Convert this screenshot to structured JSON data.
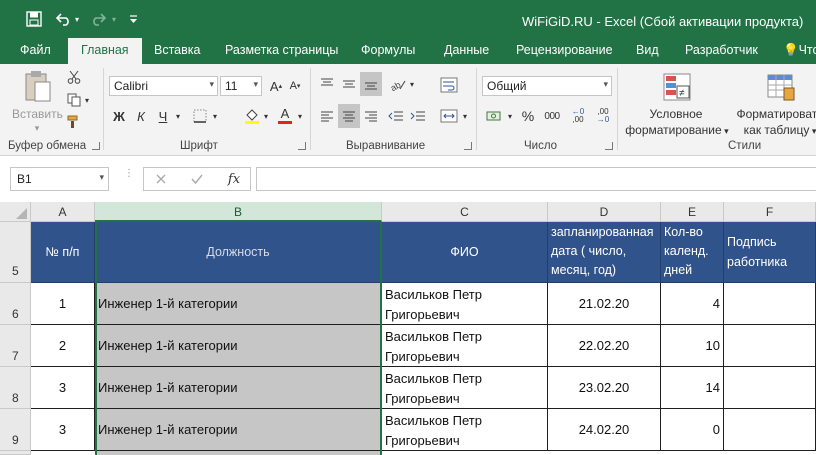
{
  "window": {
    "title": "WiFiGiD.RU - Excel (Сбой активации продукта)"
  },
  "tabs": [
    {
      "label": "Файл"
    },
    {
      "label": "Главная"
    },
    {
      "label": "Вставка"
    },
    {
      "label": "Разметка страницы"
    },
    {
      "label": "Формулы"
    },
    {
      "label": "Данные"
    },
    {
      "label": "Рецензирование"
    },
    {
      "label": "Вид"
    },
    {
      "label": "Разработчик"
    },
    {
      "label": "Что"
    }
  ],
  "ribbon": {
    "clipboard": {
      "label": "Буфер обмена",
      "paste_label": "Вставить"
    },
    "font": {
      "label": "Шрифт",
      "font_name": "Calibri",
      "font_size": "11",
      "bold": "Ж",
      "italic": "К",
      "underline": "Ч",
      "font_color_letter": "А"
    },
    "alignment": {
      "label": "Выравнивание"
    },
    "number": {
      "label": "Число",
      "format": "Общий",
      "percent": "%",
      "thousands": "000"
    },
    "styles": {
      "label": "Стили",
      "conditional_line1": "Условное",
      "conditional_line2": "форматирование",
      "table_line1": "Форматировать",
      "table_line2": "как таблицу"
    }
  },
  "formula_bar": {
    "name_box": "B1",
    "fx": "fx",
    "formula": ""
  },
  "columns": [
    "A",
    "B",
    "C",
    "D",
    "E",
    "F"
  ],
  "header_row": {
    "row_num": "5",
    "a": "№ п/п",
    "b": "Должность",
    "c": "ФИО",
    "d": "запланированная дата ( число, месяц, год)",
    "e": "Кол-во календ. дней",
    "f": "Подпись работника"
  },
  "rows": [
    {
      "row_num": "6",
      "a": "1",
      "b": "Инженер 1-й категории",
      "c": "Васильков Петр Григорьевич",
      "d": "21.02.20",
      "e": "4",
      "f": ""
    },
    {
      "row_num": "7",
      "a": "2",
      "b": "Инженер 1-й категории",
      "c": "Васильков Петр Григорьевич",
      "d": "22.02.20",
      "e": "10",
      "f": ""
    },
    {
      "row_num": "8",
      "a": "3",
      "b": "Инженер 1-й категории",
      "c": "Васильков Петр Григорьевич",
      "d": "23.02.20",
      "e": "14",
      "f": ""
    },
    {
      "row_num": "9",
      "a": "3",
      "b": "Инженер 1-й категории",
      "c": "Васильков Петр Григорьевич",
      "d": "24.02.20",
      "e": "0",
      "f": ""
    }
  ],
  "colors": {
    "excel_green": "#217346",
    "header_blue": "#31538b",
    "selected_gray": "#c6c6c6"
  },
  "icons": [
    "save-icon",
    "undo-icon",
    "redo-icon",
    "customize-qat-icon",
    "lightbulb-icon",
    "paste-icon",
    "cut-icon",
    "copy-icon",
    "format-painter-icon",
    "fill-color-icon",
    "borders-icon",
    "align-icon",
    "wrap-text-icon",
    "merge-icon",
    "currency-icon",
    "conditional-format-icon",
    "table-format-icon",
    "cancel-icon",
    "confirm-icon"
  ]
}
